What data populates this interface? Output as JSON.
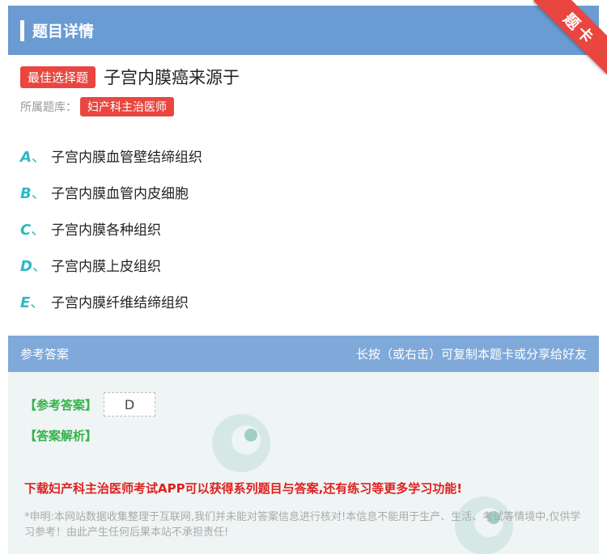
{
  "header": {
    "title": "题目详情"
  },
  "ribbon": {
    "label": "题卡"
  },
  "question": {
    "type_tag": "最佳选择题",
    "text": "子宫内膜癌来源于"
  },
  "bank": {
    "label": "所属题库：",
    "name": "妇产科主治医师"
  },
  "options": [
    {
      "letter": "A",
      "sep": "、",
      "text": "子宫内膜血管壁结缔组织"
    },
    {
      "letter": "B",
      "sep": "、",
      "text": "子宫内膜血管内皮细胞"
    },
    {
      "letter": "C",
      "sep": "、",
      "text": "子宫内膜各种组织"
    },
    {
      "letter": "D",
      "sep": "、",
      "text": "子宫内膜上皮组织"
    },
    {
      "letter": "E",
      "sep": "、",
      "text": "子宫内膜纤维结缔组织"
    }
  ],
  "answer": {
    "section_title": "参考答案",
    "share_hint": "长按（或右击）可复制本题卡或分享给好友",
    "answer_label": "【参考答案】",
    "answer_value": "D",
    "analysis_label": "【答案解析】",
    "promo": "下载妇产科主治医师考试APP可以获得系列题目与答案,还有练习等更多学习功能!",
    "disclaimer": "*申明:本网站数据收集整理于互联网,我们并未能对答案信息进行核对!本信息不能用于生产、生活、考试等情境中,仅供学习参考！由此产生任何后果本站不承担责任!"
  },
  "colors": {
    "header_bg": "#6a9bd2",
    "accent_red": "#e9463f",
    "option_letter": "#2fb8c4",
    "answer_label": "#34b24a",
    "promo": "#e02020"
  }
}
